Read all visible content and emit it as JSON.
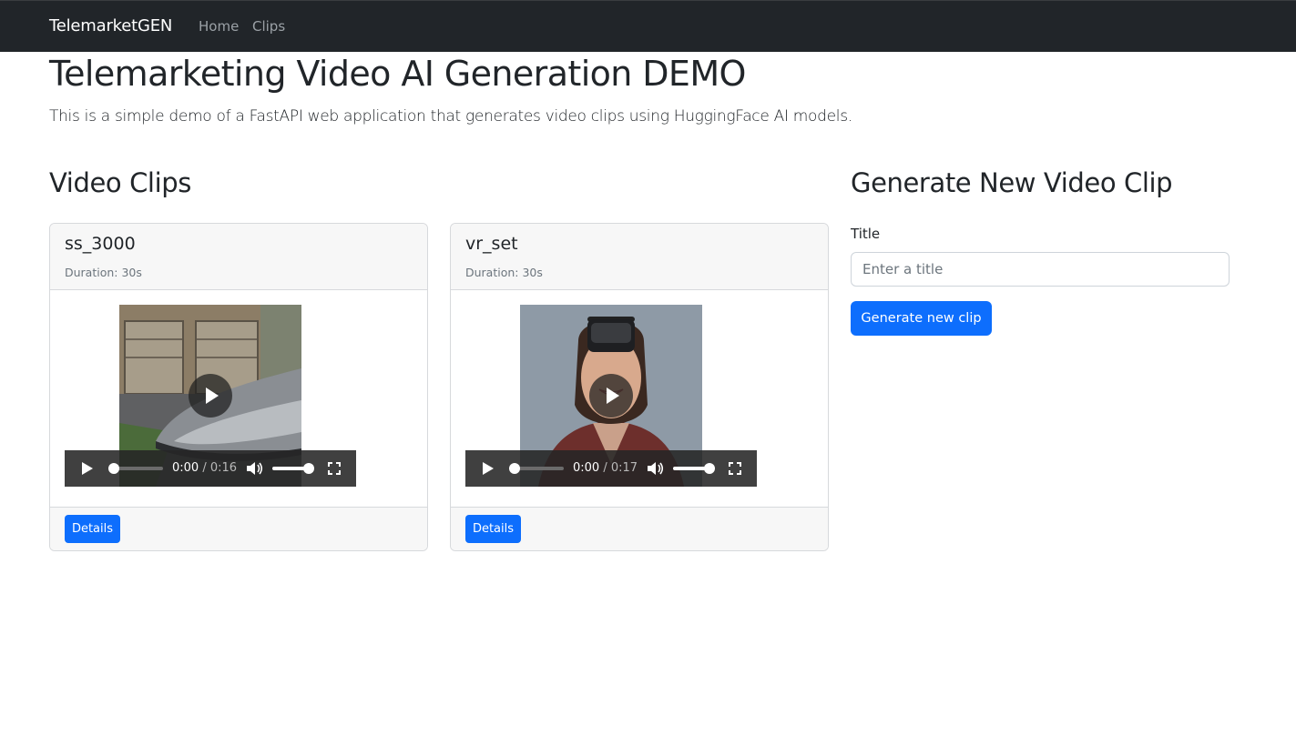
{
  "navbar": {
    "brand": "TelemarketGEN",
    "links": [
      {
        "label": "Home"
      },
      {
        "label": "Clips"
      }
    ]
  },
  "header": {
    "title": "Telemarketing Video AI Generation DEMO",
    "lead": "This is a simple demo of a FastAPI web application that generates video clips using HuggingFace AI models."
  },
  "clips_section": {
    "title": "Video Clips",
    "clips": [
      {
        "name": "ss_3000",
        "duration_label": "Duration: 30s",
        "player": {
          "current_time": "0:00",
          "separator": " / ",
          "total_time": "0:16",
          "progress": 0.0,
          "volume": 1.0
        },
        "details_label": "Details"
      },
      {
        "name": "vr_set",
        "duration_label": "Duration: 30s",
        "player": {
          "current_time": "0:00",
          "separator": " / ",
          "total_time": "0:17",
          "progress": 0.0,
          "volume": 1.0
        },
        "details_label": "Details"
      }
    ]
  },
  "generate": {
    "title": "Generate New Video Clip",
    "field_label": "Title",
    "input_value": "",
    "input_placeholder": "Enter a title",
    "button_label": "Generate new clip"
  },
  "colors": {
    "navbar_bg": "#212529",
    "primary": "#0d6efd",
    "card_header_bg": "#f7f7f7",
    "muted_text": "#6c757d"
  },
  "icons": {
    "play": "play-icon",
    "volume": "volume-icon",
    "fullscreen": "fullscreen-icon"
  }
}
